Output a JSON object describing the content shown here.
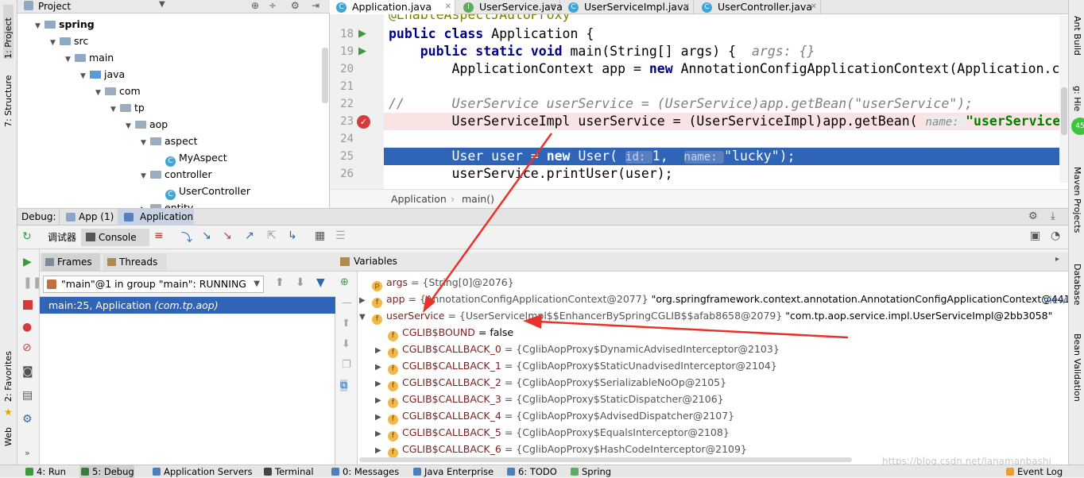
{
  "left_tabs": [
    "1: Project",
    "7: Structure",
    "2: Favorites",
    "Web"
  ],
  "right_tabs": [
    "Ant Build",
    "g: Hie",
    "Maven Projects",
    "Database",
    "Bean Validation"
  ],
  "right_badge": "45",
  "project": {
    "title": "Project",
    "tree": [
      {
        "label": "spring",
        "depth": 0,
        "arrow": "▼",
        "icon": "folder",
        "bold": true
      },
      {
        "label": "src",
        "depth": 1,
        "arrow": "▼",
        "icon": "folder"
      },
      {
        "label": "main",
        "depth": 2,
        "arrow": "▼",
        "icon": "folder"
      },
      {
        "label": "java",
        "depth": 3,
        "arrow": "▼",
        "icon": "folder-src"
      },
      {
        "label": "com",
        "depth": 4,
        "arrow": "▼",
        "icon": "package"
      },
      {
        "label": "tp",
        "depth": 5,
        "arrow": "▼",
        "icon": "package"
      },
      {
        "label": "aop",
        "depth": 6,
        "arrow": "▼",
        "icon": "package"
      },
      {
        "label": "aspect",
        "depth": 7,
        "arrow": "▼",
        "icon": "package"
      },
      {
        "label": "MyAspect",
        "depth": 8,
        "arrow": "",
        "icon": "class"
      },
      {
        "label": "controller",
        "depth": 7,
        "arrow": "▼",
        "icon": "package"
      },
      {
        "label": "UserController",
        "depth": 8,
        "arrow": "",
        "icon": "class"
      },
      {
        "label": "entity",
        "depth": 7,
        "arrow": "▶",
        "icon": "package"
      }
    ]
  },
  "editor": {
    "tabs": [
      {
        "label": "Application.java",
        "icon": "C",
        "color": "#3ea6d8",
        "active": true
      },
      {
        "label": "UserService.java",
        "icon": "I",
        "color": "#5faa5f"
      },
      {
        "label": "UserServiceImpl.java",
        "icon": "C",
        "color": "#3ea6d8"
      },
      {
        "label": "UserController.java",
        "icon": "C",
        "color": "#3ea6d8"
      }
    ],
    "top_partial": "@EnableAspectJAutoProxy",
    "lines": [
      {
        "n": "18",
        "segs": [
          [
            "kw",
            "public class "
          ],
          [
            "",
            "Application {"
          ]
        ]
      },
      {
        "n": "19",
        "segs": [
          [
            "",
            "    "
          ],
          [
            "kw",
            "public static void "
          ],
          [
            "",
            "main(String[] args) {  "
          ],
          [
            "cm",
            "args: {}"
          ]
        ]
      },
      {
        "n": "20",
        "segs": [
          [
            "",
            "        ApplicationContext app = "
          ],
          [
            "kw",
            "new "
          ],
          [
            "",
            "AnnotationConfigApplicationContext(Application.cl"
          ]
        ]
      },
      {
        "n": "21",
        "segs": []
      },
      {
        "n": "22",
        "segs": [
          [
            "cm",
            "//      UserService userService = (UserService)app.getBean(\"userService\");"
          ]
        ]
      },
      {
        "n": "23",
        "segs": [
          [
            "",
            "        UserServiceImpl userService = (UserServiceImpl)app.getBean( "
          ],
          [
            "hint",
            "name: "
          ],
          [
            "str",
            "\"userService\""
          ]
        ],
        "bp": true
      },
      {
        "n": "24",
        "segs": []
      },
      {
        "n": "25",
        "segs": [
          [
            "",
            "        User user = "
          ],
          [
            "kw",
            "new "
          ],
          [
            "",
            "User( "
          ],
          [
            "hintsel",
            "id: "
          ],
          [
            "",
            "1,  "
          ],
          [
            "hintsel",
            "name: "
          ],
          [
            "",
            "\"lucky\");"
          ]
        ],
        "sel": true
      },
      {
        "n": "26",
        "segs": [
          [
            "",
            "        userService.printUser(user);"
          ]
        ]
      }
    ],
    "breadcrumb": [
      "Application",
      "main()"
    ]
  },
  "debug": {
    "label": "Debug:",
    "tabs": [
      "App (1)",
      "Application"
    ],
    "subtabs": [
      "调试器",
      "Console"
    ],
    "frames_tab": "Frames",
    "threads_tab": "Threads",
    "thread_select": "\"main\"@1 in group \"main\": RUNNING",
    "frame_selected": "main:25, Application",
    "frame_selected_pkg": "(com.tp.aop)",
    "variables_title": "Variables",
    "view_link": "View",
    "vars": [
      {
        "arrow": "",
        "icon": "p",
        "name": "args",
        "value": " = {String[0]@2076}",
        "extra": "",
        "indent": 0
      },
      {
        "arrow": "▶",
        "icon": "f",
        "name": "app",
        "value": " = {AnnotationConfigApplicationContext@2077}",
        "extra": " \"org.springframework.context.annotation.AnnotationConfigApplicationContext@4411d9...",
        "indent": 0
      },
      {
        "arrow": "▼",
        "icon": "f",
        "name": "userService",
        "value": " = {UserServiceImpl$$EnhancerBySpringCGLIB$$afab8658@2079}",
        "extra": " \"com.tp.aop.service.impl.UserServiceImpl@2bb3058\"",
        "indent": 0
      },
      {
        "arrow": "",
        "icon": "f",
        "name": "CGLIB$BOUND",
        "value": "",
        "extra": " = false",
        "indent": 1
      },
      {
        "arrow": "▶",
        "icon": "f",
        "name": "CGLIB$CALLBACK_0",
        "value": " = {CglibAopProxy$DynamicAdvisedInterceptor@2103}",
        "extra": "",
        "indent": 1
      },
      {
        "arrow": "▶",
        "icon": "f",
        "name": "CGLIB$CALLBACK_1",
        "value": " = {CglibAopProxy$StaticUnadvisedInterceptor@2104}",
        "extra": "",
        "indent": 1
      },
      {
        "arrow": "▶",
        "icon": "f",
        "name": "CGLIB$CALLBACK_2",
        "value": " = {CglibAopProxy$SerializableNoOp@2105}",
        "extra": "",
        "indent": 1
      },
      {
        "arrow": "▶",
        "icon": "f",
        "name": "CGLIB$CALLBACK_3",
        "value": " = {CglibAopProxy$StaticDispatcher@2106}",
        "extra": "",
        "indent": 1
      },
      {
        "arrow": "▶",
        "icon": "f",
        "name": "CGLIB$CALLBACK_4",
        "value": " = {CglibAopProxy$AdvisedDispatcher@2107}",
        "extra": "",
        "indent": 1
      },
      {
        "arrow": "▶",
        "icon": "f",
        "name": "CGLIB$CALLBACK_5",
        "value": " = {CglibAopProxy$EqualsInterceptor@2108}",
        "extra": "",
        "indent": 1
      },
      {
        "arrow": "▶",
        "icon": "f",
        "name": "CGLIB$CALLBACK_6",
        "value": " = {CglibAopProxy$HashCodeInterceptor@2109}",
        "extra": "",
        "indent": 1
      }
    ]
  },
  "status_items": [
    {
      "label": "4: Run",
      "color": "#3a9a3a"
    },
    {
      "label": "5: Debug",
      "color": "#3a7a3a"
    },
    {
      "label": "Application Servers",
      "color": "#4a7fc0"
    },
    {
      "label": "Terminal",
      "color": "#444444"
    },
    {
      "label": "0: Messages",
      "color": "#4a7fc0"
    },
    {
      "label": "Java Enterprise",
      "color": "#4a7fc0"
    },
    {
      "label": "6: TODO",
      "color": "#4a7fc0"
    },
    {
      "label": "Spring",
      "color": "#5faa5f"
    },
    {
      "label": "Event Log",
      "color": "#e8a030"
    }
  ],
  "watermark": "https://blog.csdn.net/lanamanbashi"
}
